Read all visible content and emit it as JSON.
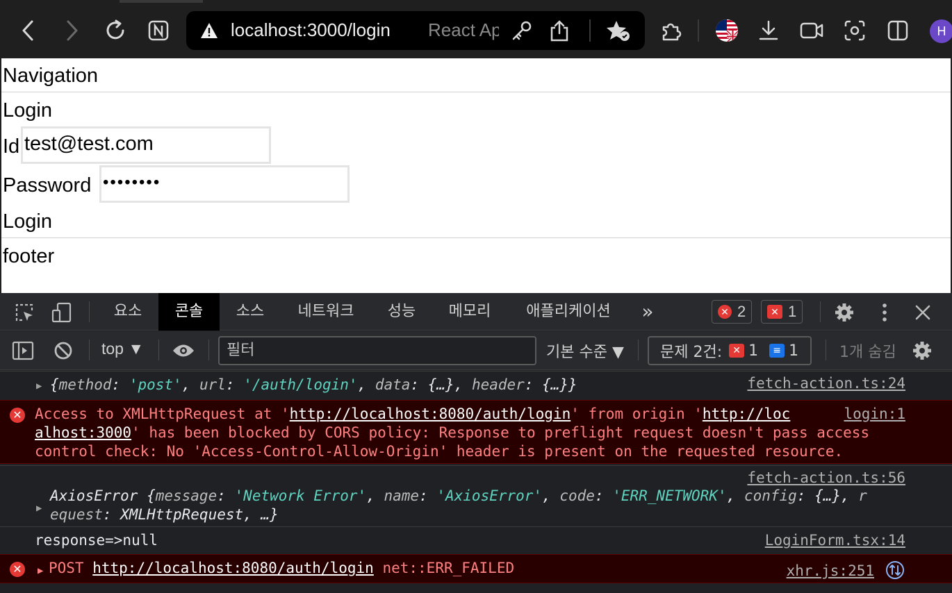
{
  "browser": {
    "url": "localhost:3000/login",
    "page_title": "React App",
    "avatar_initial": "H"
  },
  "page": {
    "nav": "Navigation",
    "heading": "Login",
    "id_label": "Id",
    "id_value": "test@test.com",
    "password_label": "Password",
    "password_value": "••••••••",
    "login_button": "Login",
    "footer": "footer"
  },
  "devtools": {
    "tabs": [
      "요소",
      "콘솔",
      "소스",
      "네트워크",
      "성능",
      "메모리",
      "애플리케이션"
    ],
    "active_tab": "콘솔",
    "more": "»",
    "error_count": "2",
    "warning_count": "1",
    "context": "top ▼",
    "filter_placeholder": "필터",
    "levels": "기본 수준 ▼",
    "issues_label": "문제 2건:",
    "issues_errors": "1",
    "issues_info": "1",
    "hidden": "1개 숨김",
    "logs": [
      {
        "type": "info",
        "prefix": "▶",
        "text_parts": [
          {
            "t": "{",
            "c": "plain"
          },
          {
            "t": "method",
            "c": "key"
          },
          {
            "t": ": ",
            "c": "plain"
          },
          {
            "t": "'post'",
            "c": "str"
          },
          {
            "t": ", ",
            "c": "plain"
          },
          {
            "t": "url",
            "c": "key"
          },
          {
            "t": ": ",
            "c": "plain"
          },
          {
            "t": "'/auth/login'",
            "c": "str"
          },
          {
            "t": ", ",
            "c": "plain"
          },
          {
            "t": "data",
            "c": "key"
          },
          {
            "t": ": {…}, ",
            "c": "plain"
          },
          {
            "t": "header",
            "c": "key"
          },
          {
            "t": ": {…}}",
            "c": "plain"
          }
        ],
        "source": "fetch-action.ts:24"
      },
      {
        "type": "error",
        "line1_a": "Access to XMLHttpRequest at '",
        "link1": "http://localhost:8080/auth/login",
        "line1_b": "' from origin '",
        "link2a": "http://loc",
        "link2b": "alhost:3000",
        "line2_b": "' has been blocked by CORS policy: Response to preflight request doesn't pass access",
        "line3": "control check: No 'Access-Control-Allow-Origin' header is present on the requested resource.",
        "source": "login:1"
      },
      {
        "type": "info",
        "source": "fetch-action.ts:56",
        "prefix": "▶",
        "line1_parts": [
          {
            "t": "AxiosError {",
            "c": "plain"
          },
          {
            "t": "message",
            "c": "key"
          },
          {
            "t": ": ",
            "c": "plain"
          },
          {
            "t": "'Network Error'",
            "c": "str"
          },
          {
            "t": ", ",
            "c": "plain"
          },
          {
            "t": "name",
            "c": "key"
          },
          {
            "t": ": ",
            "c": "plain"
          },
          {
            "t": "'AxiosError'",
            "c": "str"
          },
          {
            "t": ", ",
            "c": "plain"
          },
          {
            "t": "code",
            "c": "key"
          },
          {
            "t": ": ",
            "c": "plain"
          },
          {
            "t": "'ERR_NETWORK'",
            "c": "str"
          },
          {
            "t": ", ",
            "c": "plain"
          },
          {
            "t": "config",
            "c": "key"
          },
          {
            "t": ": {…}, ",
            "c": "plain"
          },
          {
            "t": "r",
            "c": "key"
          }
        ],
        "line2_parts": [
          {
            "t": "equest",
            "c": "key"
          },
          {
            "t": ": XMLHttpRequest, …}",
            "c": "plain"
          }
        ]
      },
      {
        "type": "info",
        "text": "response=>null",
        "source": "LoginForm.tsx:14"
      },
      {
        "type": "error",
        "prefix": "▶",
        "method": "POST",
        "link": "http://localhost:8080/auth/login",
        "status": "net::ERR_FAILED",
        "source": "xhr.js:251"
      }
    ]
  }
}
